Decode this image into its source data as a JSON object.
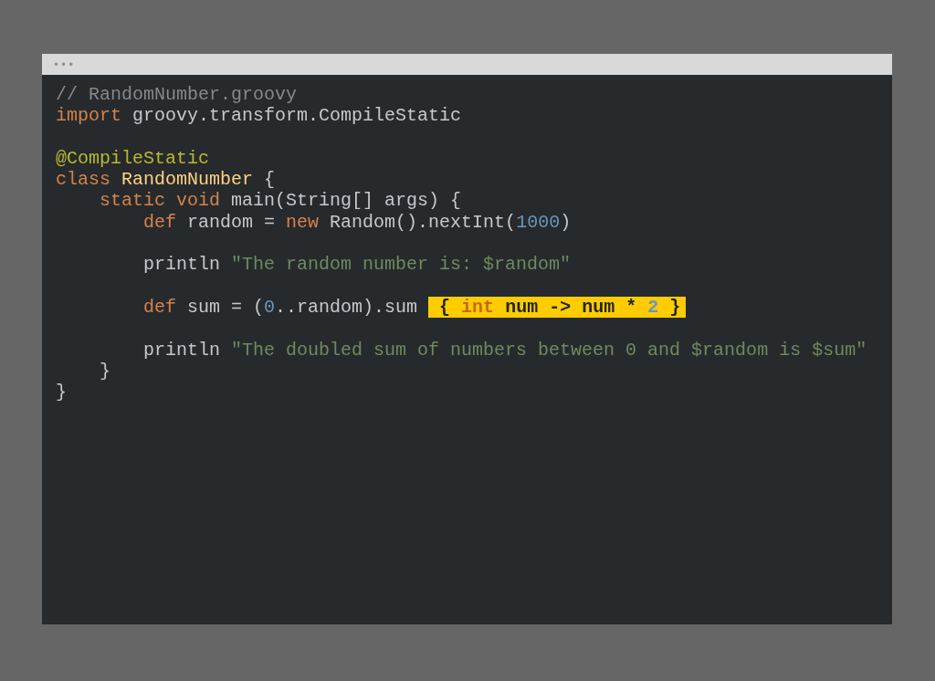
{
  "window": {
    "controls": "•••"
  },
  "code_lines": [
    {
      "kind": "code",
      "tokens": [
        {
          "text": "// RandomNumber.groovy",
          "kind": "comment"
        }
      ]
    },
    {
      "kind": "code",
      "tokens": [
        {
          "text": "import",
          "kind": "keyword"
        },
        {
          "text": " groovy.transform.CompileStatic",
          "kind": "plain"
        }
      ]
    },
    {
      "kind": "blank"
    },
    {
      "kind": "code",
      "tokens": [
        {
          "text": "@CompileStatic",
          "kind": "annotation"
        }
      ]
    },
    {
      "kind": "code",
      "tokens": [
        {
          "text": "class",
          "kind": "keyword"
        },
        {
          "text": " RandomNumber",
          "kind": "classname"
        },
        {
          "text": " {",
          "kind": "plain"
        }
      ]
    },
    {
      "kind": "code",
      "tokens": [
        {
          "text": "    static void",
          "kind": "keyword"
        },
        {
          "text": " main(String[] args) {",
          "kind": "plain"
        }
      ]
    },
    {
      "kind": "code",
      "tokens": [
        {
          "text": "        def",
          "kind": "keyword"
        },
        {
          "text": " random = ",
          "kind": "plain"
        },
        {
          "text": "new",
          "kind": "keyword"
        },
        {
          "text": " Random().nextInt(",
          "kind": "plain"
        },
        {
          "text": "1000",
          "kind": "number"
        },
        {
          "text": ")",
          "kind": "plain"
        }
      ]
    },
    {
      "kind": "blank"
    },
    {
      "kind": "code",
      "tokens": [
        {
          "text": "        println ",
          "kind": "plain"
        },
        {
          "text": "\"The random number is: $random\"",
          "kind": "string"
        }
      ]
    },
    {
      "kind": "blank"
    },
    {
      "kind": "code",
      "tokens": [
        {
          "text": "        def",
          "kind": "keyword"
        },
        {
          "text": " sum = (",
          "kind": "plain"
        },
        {
          "text": "0",
          "kind": "number"
        },
        {
          "text": "..random).sum ",
          "kind": "plain"
        }
      ],
      "highlighted_tokens": [
        {
          "text": " { ",
          "kind": "plain"
        },
        {
          "text": "int",
          "kind": "keyword"
        },
        {
          "text": " num -> num * ",
          "kind": "plain"
        },
        {
          "text": "2",
          "kind": "number"
        },
        {
          "text": " }",
          "kind": "plain"
        }
      ]
    },
    {
      "kind": "blank"
    },
    {
      "kind": "code",
      "tokens": [
        {
          "text": "        println ",
          "kind": "plain"
        },
        {
          "text": "\"The doubled sum of numbers between 0 and $random is $sum\"",
          "kind": "string"
        }
      ]
    },
    {
      "kind": "code",
      "tokens": [
        {
          "text": "    }",
          "kind": "plain"
        }
      ]
    },
    {
      "kind": "code",
      "tokens": [
        {
          "text": "}",
          "kind": "plain"
        }
      ]
    }
  ]
}
